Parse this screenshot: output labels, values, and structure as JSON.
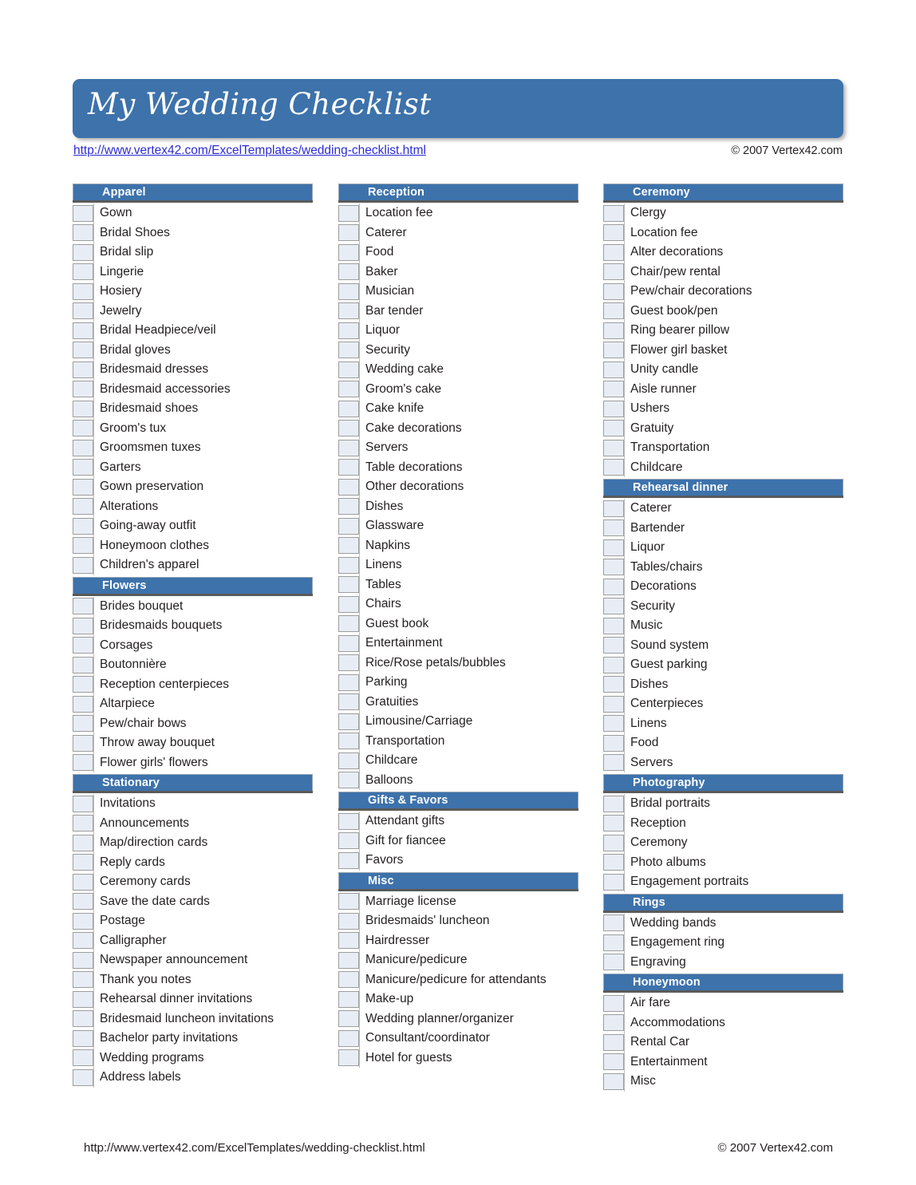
{
  "document": {
    "title": "My Wedding Checklist",
    "header_url": "http://www.vertex42.com/ExcelTemplates/wedding-checklist.html",
    "header_copyright": "© 2007 Vertex42.com",
    "footer_url": "http://www.vertex42.com/ExcelTemplates/wedding-checklist.html",
    "footer_copyright": "© 2007 Vertex42.com"
  },
  "colors": {
    "accent_blue": "#3d72ab",
    "checkbox_fill": "#e8edf5",
    "checkbox_border": "#9d9d9d",
    "header_shadow": "#5a5a5a",
    "link_blue": "#2b2bd4",
    "text": "#231f20"
  },
  "columns": [
    {
      "sections": [
        {
          "title": "Apparel",
          "items": [
            "Gown",
            "Bridal Shoes",
            "Bridal slip",
            "Lingerie",
            "Hosiery",
            "Jewelry",
            "Bridal Headpiece/veil",
            "Bridal gloves",
            "Bridesmaid dresses",
            "Bridesmaid accessories",
            "Bridesmaid shoes",
            "Groom's tux",
            "Groomsmen tuxes",
            "Garters",
            "Gown preservation",
            "Alterations",
            "Going-away outfit",
            "Honeymoon clothes",
            "Children's apparel"
          ]
        },
        {
          "title": "Flowers",
          "items": [
            "Brides bouquet",
            "Bridesmaids bouquets",
            "Corsages",
            "Boutonnière",
            "Reception centerpieces",
            "Altarpiece",
            "Pew/chair bows",
            "Throw away bouquet",
            "Flower girls' flowers"
          ]
        },
        {
          "title": "Stationary",
          "items": [
            "Invitations",
            "Announcements",
            "Map/direction cards",
            "Reply cards",
            "Ceremony cards",
            "Save the date cards",
            "Postage",
            "Calligrapher",
            "Newspaper announcement",
            "Thank you notes",
            "Rehearsal dinner invitations",
            "Bridesmaid luncheon invitations",
            "Bachelor party invitations",
            "Wedding programs",
            "Address labels"
          ]
        }
      ]
    },
    {
      "sections": [
        {
          "title": "Reception",
          "items": [
            "Location fee",
            "Caterer",
            "Food",
            "Baker",
            "Musician",
            "Bar tender",
            "Liquor",
            "Security",
            "Wedding cake",
            "Groom's cake",
            "Cake knife",
            "Cake decorations",
            "Servers",
            "Table decorations",
            "Other decorations",
            "Dishes",
            "Glassware",
            "Napkins",
            "Linens",
            "Tables",
            "Chairs",
            "Guest book",
            "Entertainment",
            "Rice/Rose petals/bubbles",
            "Parking",
            "Gratuities",
            "Limousine/Carriage",
            "Transportation",
            "Childcare",
            "Balloons"
          ]
        },
        {
          "title": "Gifts & Favors",
          "items": [
            "Attendant gifts",
            "Gift for fiancee",
            "Favors"
          ]
        },
        {
          "title": "Misc",
          "items": [
            "Marriage license",
            "Bridesmaids' luncheon",
            "Hairdresser",
            "Manicure/pedicure",
            "Manicure/pedicure for attendants",
            "Make-up",
            "Wedding planner/organizer",
            "Consultant/coordinator",
            "Hotel for guests"
          ]
        }
      ]
    },
    {
      "sections": [
        {
          "title": "Ceremony",
          "items": [
            "Clergy",
            "Location fee",
            "Alter decorations",
            "Chair/pew rental",
            "Pew/chair decorations",
            "Guest book/pen",
            "Ring bearer pillow",
            "Flower girl basket",
            "Unity candle",
            "Aisle runner",
            "Ushers",
            "Gratuity",
            "Transportation",
            "Childcare"
          ]
        },
        {
          "title": "Rehearsal dinner",
          "items": [
            "Caterer",
            "Bartender",
            "Liquor",
            "Tables/chairs",
            "Decorations",
            "Security",
            "Music",
            "Sound system",
            "Guest parking",
            "Dishes",
            "Centerpieces",
            "Linens",
            "Food",
            "Servers"
          ]
        },
        {
          "title": "Photography",
          "items": [
            "Bridal portraits",
            "Reception",
            "Ceremony",
            "Photo albums",
            "Engagement portraits"
          ]
        },
        {
          "title": "Rings",
          "items": [
            "Wedding bands",
            "Engagement ring",
            "Engraving"
          ]
        },
        {
          "title": "Honeymoon",
          "items": [
            "Air fare",
            "Accommodations",
            "Rental Car",
            "Entertainment",
            "Misc"
          ]
        }
      ]
    }
  ]
}
